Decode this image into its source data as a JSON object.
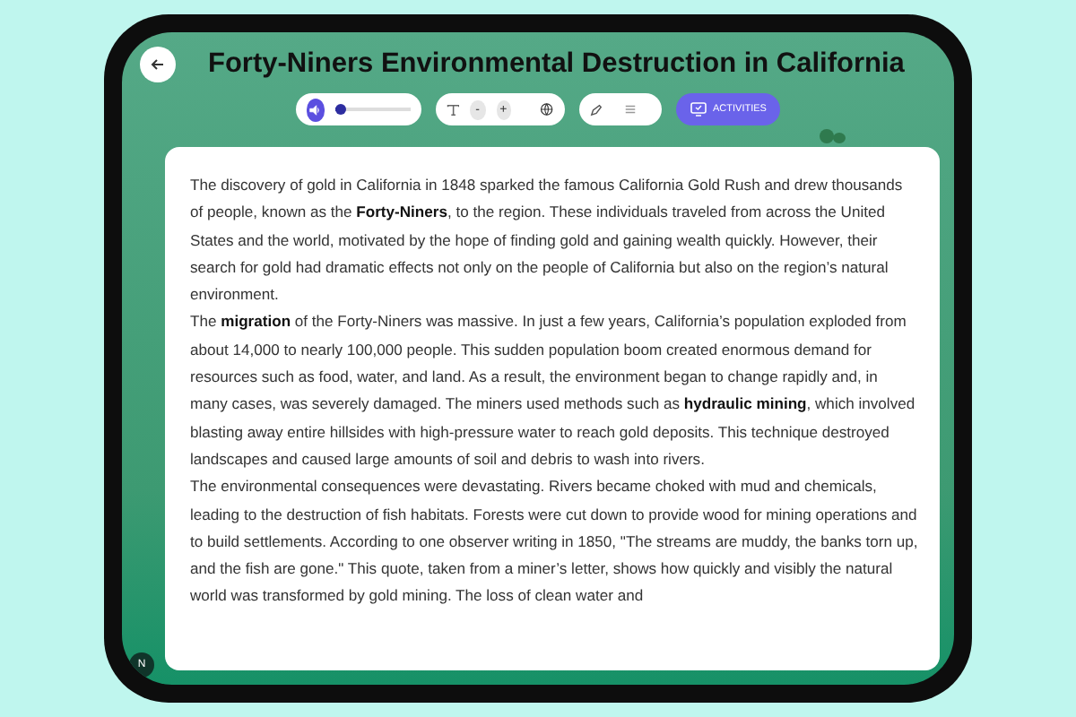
{
  "header": {
    "title": "Forty-Niners Environmental Destruction in California"
  },
  "toolbar": {
    "audio": {
      "level": 0.06
    },
    "text_size": {
      "decrease": "-",
      "increase": "+"
    },
    "activities_button": "ACTIVITIES"
  },
  "article": {
    "paragraphs": [
      "The discovery of gold in California in 1848 sparked the famous California Gold Rush and drew thousands of people, known as the **Forty-Niners**, to the region. These individuals traveled from across the United States and the world, motivated by the hope of finding gold and gaining wealth quickly. However, their search for gold had dramatic effects not only on the people of California but also on the region’s natural environment.",
      "The **migration** of the Forty-Niners was massive. In just a few years, California’s population exploded from about 14,000 to nearly 100,000 people. This sudden population boom created enormous demand for resources such as food, water, and land. As a result, the environment began to change rapidly and, in many cases, was severely damaged. The miners used methods such as **hydraulic mining**, which involved blasting away entire hillsides with high-pressure water to reach gold deposits. This technique destroyed landscapes and caused large amounts of soil and debris to wash into rivers.",
      "The environmental consequences were devastating. Rivers became choked with mud and chemicals, leading to the destruction of fish habitats. Forests were cut down to provide wood for mining operations and to build settlements. According to one observer writing in 1850, \"The streams are muddy, the banks torn up, and the fish are gone.\" This quote, taken from a miner’s letter, shows how quickly and visibly the natural world was transformed by gold mining. The loss of clean water and"
    ]
  },
  "corner_badge": "N"
}
